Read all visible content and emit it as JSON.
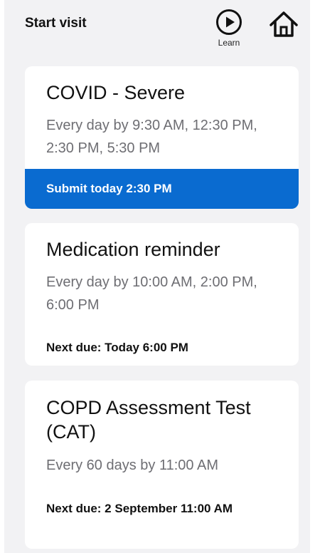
{
  "header": {
    "start_visit_label": "Start visit",
    "learn_label": "Learn",
    "accent_color": "#0a6bd0"
  },
  "cards": [
    {
      "title": "COVID - Severe",
      "schedule": "Every day by 9:30 AM, 12:30 PM, 2:30 PM, 5:30 PM",
      "action_label": "Submit today 2:30 PM"
    },
    {
      "title": "Medication reminder",
      "schedule": "Every day by 10:00 AM, 2:00 PM, 6:00 PM",
      "next_due": "Next due: Today 6:00 PM"
    },
    {
      "title": "COPD Assessment Test (CAT)",
      "schedule": "Every 60 days by 11:00 AM",
      "next_due": "Next due: 2 September 11:00 AM"
    }
  ],
  "icons": {
    "learn": "play-circle-icon",
    "home": "home-icon"
  }
}
